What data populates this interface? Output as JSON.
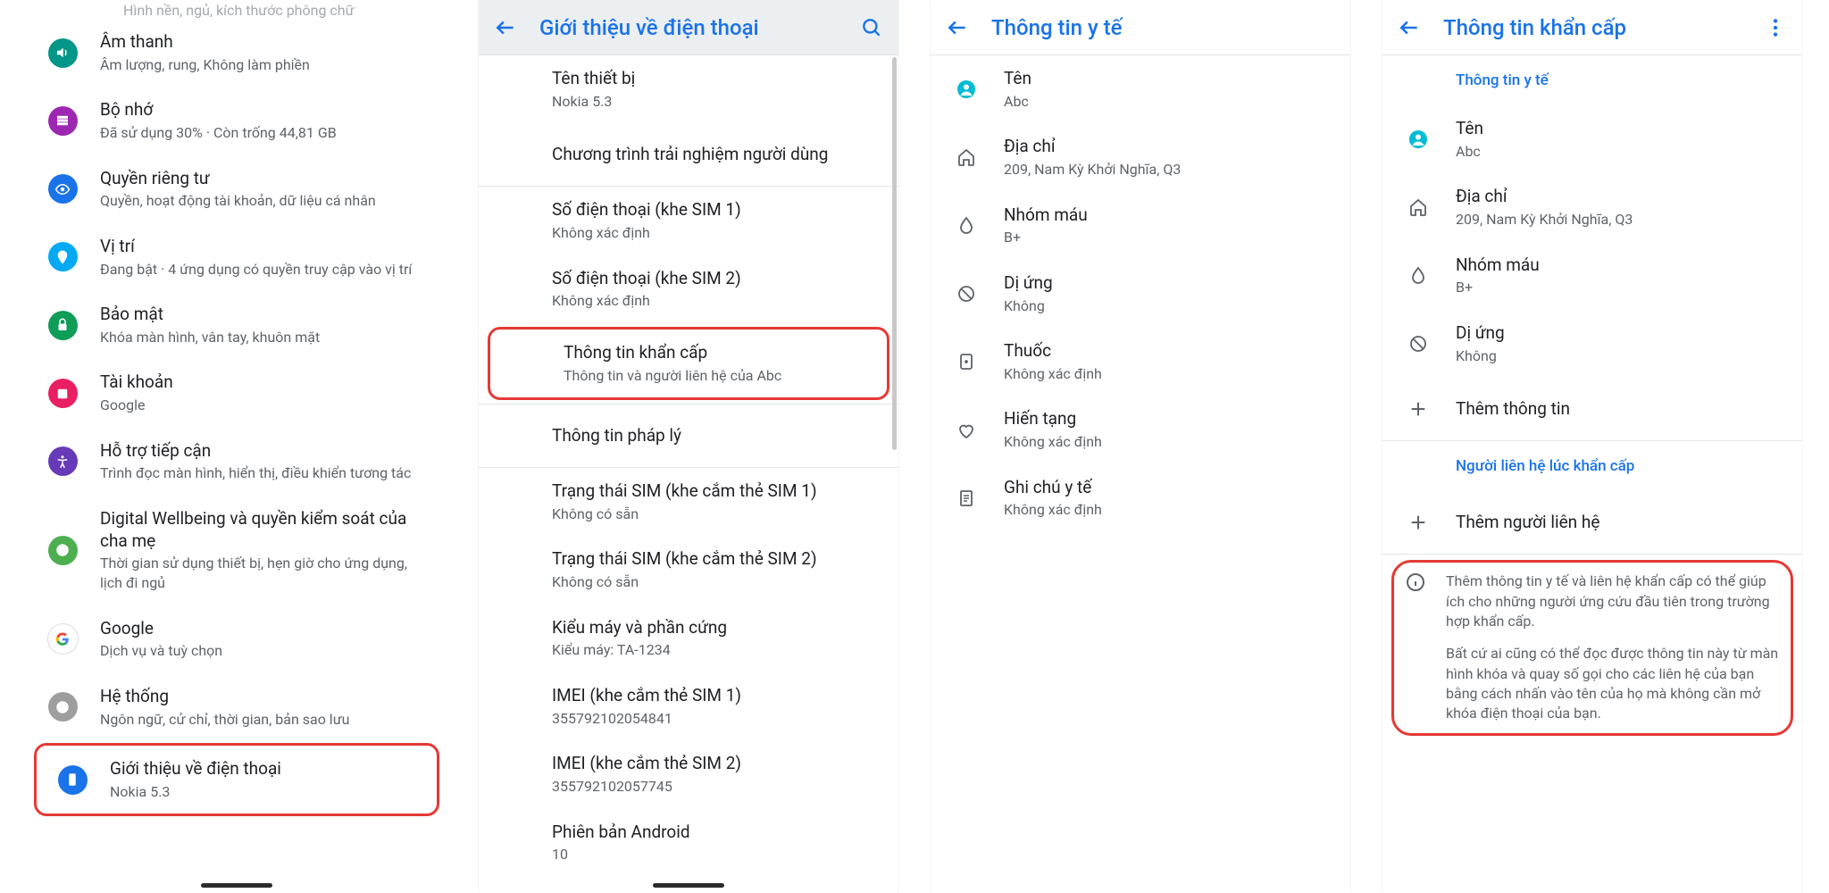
{
  "colors": {
    "teal": "#009688",
    "purple": "#9c27b0",
    "blue": "#1a73e8",
    "cyan": "#03a9f4",
    "green": "#0f9d58",
    "pink": "#e91e63",
    "deepPurple": "#673ab7",
    "greenAlt": "#4caf50",
    "grey": "#9e9e9e",
    "orange": "#fb8c00"
  },
  "s1": {
    "top_sub": "Hình nền, ngủ, kích thước phông chữ",
    "items": [
      {
        "t": "Âm thanh",
        "s": "Âm lượng, rung, Không làm phiền",
        "c": "teal",
        "icon": "volume"
      },
      {
        "t": "Bộ nhớ",
        "s": "Đã sử dụng 30% · Còn trống 44,81 GB",
        "c": "purple",
        "icon": "storage"
      },
      {
        "t": "Quyền riêng tư",
        "s": "Quyền, hoạt động tài khoản, dữ liệu cá nhân",
        "c": "blue",
        "icon": "privacy"
      },
      {
        "t": "Vị trí",
        "s": "Đang bật · 4 ứng dụng có quyền truy cập vào vị trí",
        "c": "cyan",
        "icon": "location"
      },
      {
        "t": "Bảo mật",
        "s": "Khóa màn hình, vân tay, khuôn mặt",
        "c": "green",
        "icon": "lock"
      },
      {
        "t": "Tài khoản",
        "s": "Google",
        "c": "pink",
        "icon": "account"
      },
      {
        "t": "Hỗ trợ tiếp cận",
        "s": "Trình đọc màn hình, hiển thị, điều khiển tương tác",
        "c": "deepPurple",
        "icon": "a11y"
      },
      {
        "t": "Digital Wellbeing và quyền kiểm soát của cha mẹ",
        "s": "Thời gian sử dụng thiết bị, hẹn giờ cho ứng dụng, lịch đi ngủ",
        "c": "greenAlt",
        "icon": "wellbeing"
      },
      {
        "t": "Google",
        "s": "Dịch vụ và tuỳ chọn",
        "c": "white",
        "icon": "google"
      },
      {
        "t": "Hệ thống",
        "s": "Ngôn ngữ, cử chỉ, thời gian, bản sao lưu",
        "c": "grey",
        "icon": "info"
      },
      {
        "t": "Giới thiệu về điện thoại",
        "s": "Nokia 5.3",
        "c": "blue",
        "icon": "phone",
        "hl": true
      }
    ]
  },
  "s2": {
    "title": "Giới thiệu về điện thoại",
    "items": [
      {
        "t": "Tên thiết bị",
        "s": "Nokia 5.3",
        "indent": true
      },
      {
        "t": "Chương trình trải nghiệm người dùng",
        "indent": true,
        "div": true
      },
      {
        "t": "Số điện thoại (khe SIM 1)",
        "s": "Không xác định",
        "indent": true
      },
      {
        "t": "Số điện thoại (khe SIM 2)",
        "s": "Không xác định",
        "indent": true
      },
      {
        "t": "Thông tin khẩn cấp",
        "s": "Thông tin và người liên hệ của Abc",
        "indent": true,
        "hl": true,
        "div": true
      },
      {
        "t": "Thông tin pháp lý",
        "indent": true,
        "div": true
      },
      {
        "t": "Trạng thái SIM (khe cắm thẻ SIM 1)",
        "s": "Không có sẵn",
        "indent": true
      },
      {
        "t": "Trạng thái SIM (khe cắm thẻ SIM 2)",
        "s": "Không có sẵn",
        "indent": true
      },
      {
        "t": "Kiểu máy và phần cứng",
        "s": "Kiểu máy: TA-1234",
        "indent": true
      },
      {
        "t": "IMEI (khe cắm thẻ SIM 1)",
        "s": "355792102054841",
        "indent": true
      },
      {
        "t": "IMEI (khe cắm thẻ SIM 2)",
        "s": "355792102057745",
        "indent": true
      },
      {
        "t": "Phiên bản Android",
        "s": "10",
        "indent": true
      }
    ]
  },
  "s3": {
    "title": "Thông tin y tế",
    "items": [
      {
        "t": "Tên",
        "s": "Abc",
        "icon": "person"
      },
      {
        "t": "Địa chỉ",
        "s": "209, Nam Kỳ Khởi Nghĩa, Q3",
        "icon": "home"
      },
      {
        "t": "Nhóm máu",
        "s": "B+",
        "icon": "blood"
      },
      {
        "t": "Dị ứng",
        "s": "Không",
        "icon": "no"
      },
      {
        "t": "Thuốc",
        "s": "Không xác định",
        "icon": "meds"
      },
      {
        "t": "Hiến tạng",
        "s": "Không xác định",
        "icon": "heart"
      },
      {
        "t": "Ghi chú y tế",
        "s": "Không xác định",
        "icon": "note"
      }
    ]
  },
  "s4": {
    "title": "Thông tin khẩn cấp",
    "sec1": "Thông tin y tế",
    "items": [
      {
        "t": "Tên",
        "s": "Abc",
        "icon": "person"
      },
      {
        "t": "Địa chỉ",
        "s": "209, Nam Kỳ Khởi Nghĩa, Q3",
        "icon": "home"
      },
      {
        "t": "Nhóm máu",
        "s": "B+",
        "icon": "blood"
      },
      {
        "t": "Dị ứng",
        "s": "Không",
        "icon": "no"
      }
    ],
    "add_info": "Thêm thông tin",
    "sec2": "Người liên hệ lúc khẩn cấp",
    "add_contact": "Thêm người liên hệ",
    "info1": "Thêm thông tin y tế và liên hệ khẩn cấp có thể giúp ích cho những người ứng cứu đầu tiên trong trường hợp khẩn cấp.",
    "info2": "Bất cứ ai cũng có thể đọc được thông tin này từ màn hình khóa và quay số gọi cho các liên hệ của bạn bằng cách nhấn vào tên của họ mà không cần mở khóa điện thoại của bạn."
  }
}
